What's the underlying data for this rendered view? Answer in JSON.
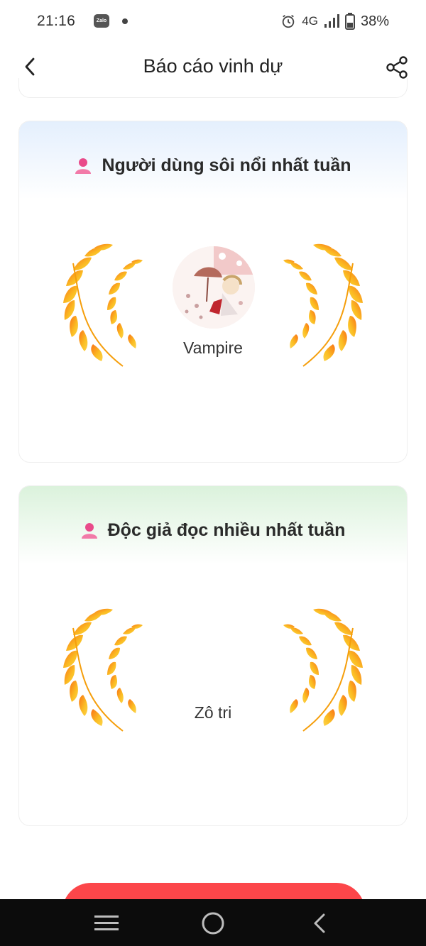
{
  "status_bar": {
    "time": "21:16",
    "zalo_label": "Zalo",
    "network": "4G",
    "battery": "38%",
    "icons": [
      "zalo-icon",
      "alarm-icon",
      "signal-icon",
      "battery-icon"
    ]
  },
  "header": {
    "title": "Báo cáo vinh dự",
    "back_icon": "chevron-left-icon",
    "share_icon": "share-icon"
  },
  "cards": [
    {
      "title": "Người dùng sôi nổi nhất tuần",
      "winner_name": "Vampire",
      "has_avatar": true,
      "header_color": "#e4effd"
    },
    {
      "title": "Độc giả đọc nhiều nhất tuần",
      "winner_name": "Zô tri",
      "has_avatar": false,
      "header_color": "#dbf2dc"
    }
  ],
  "colors": {
    "accent_red": "#fc464a",
    "laurel_gold": "#fbbf24",
    "laurel_orange": "#f97316",
    "user_icon_pink": "#e94a8a"
  },
  "nav_bar": {
    "icons": [
      "menu-icon",
      "home-icon",
      "back-icon"
    ]
  }
}
